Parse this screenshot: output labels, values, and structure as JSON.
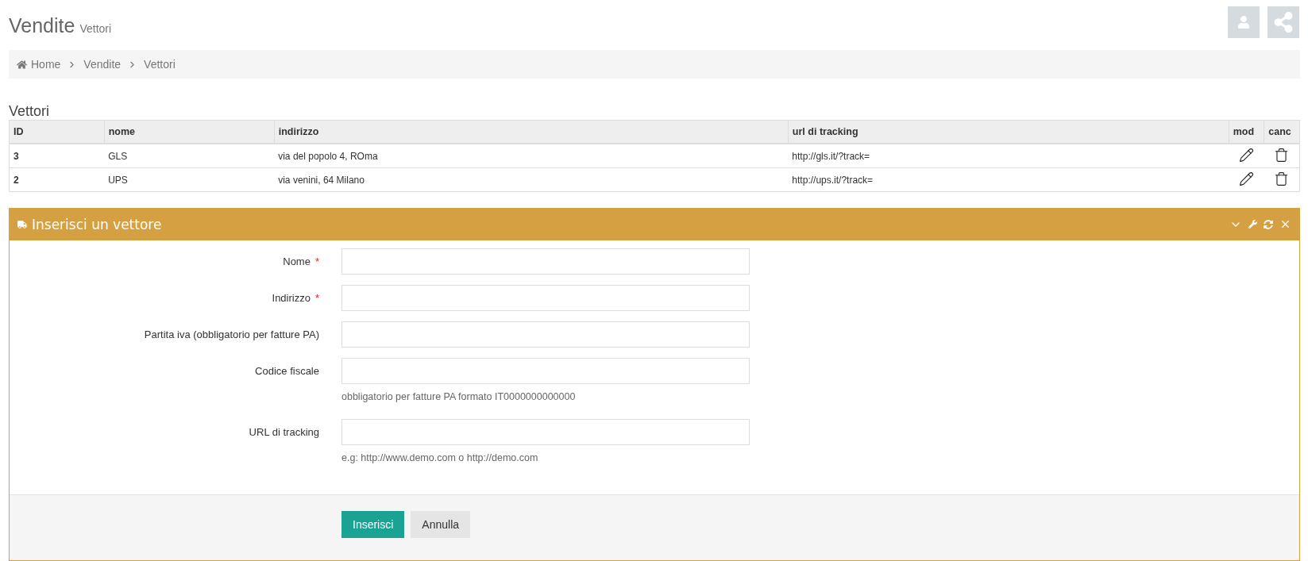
{
  "page_header": {
    "title": "Vendite",
    "subtitle": "Vettori"
  },
  "breadcrumb": [
    {
      "label": "Home",
      "kind": "home"
    },
    {
      "label": "Vendite",
      "kind": "link"
    },
    {
      "label": "Vettori",
      "kind": "link"
    }
  ],
  "table": {
    "title": "Vettori",
    "columns": [
      "ID",
      "nome",
      "indirizzo",
      "url di tracking",
      "mod",
      "canc"
    ],
    "rows": [
      {
        "id": "3",
        "nome": "GLS",
        "indirizzo": "via del popolo 4, ROma",
        "url": "http://gls.it/?track="
      },
      {
        "id": "2",
        "nome": "UPS",
        "indirizzo": "via venini, 64 Milano",
        "url": "http://ups.it/?track="
      }
    ]
  },
  "form_panel": {
    "title": "Inserisci un vettore",
    "fields": [
      {
        "label": "Nome",
        "required_mark": "*"
      },
      {
        "label": "Indirizzo",
        "required_mark": "*"
      },
      {
        "label": "Partita iva (obbligatorio per fatture PA)"
      },
      {
        "label": "Codice fiscale",
        "help": "obbligatorio per fatture PA formato IT0000000000000"
      },
      {
        "label": "URL di tracking",
        "help": "e.g: http://www.demo.com o http://demo.com"
      }
    ],
    "buttons": [
      {
        "label": "Inserisci",
        "kind": "primary"
      },
      {
        "label": "Annulla",
        "kind": "default"
      }
    ]
  }
}
